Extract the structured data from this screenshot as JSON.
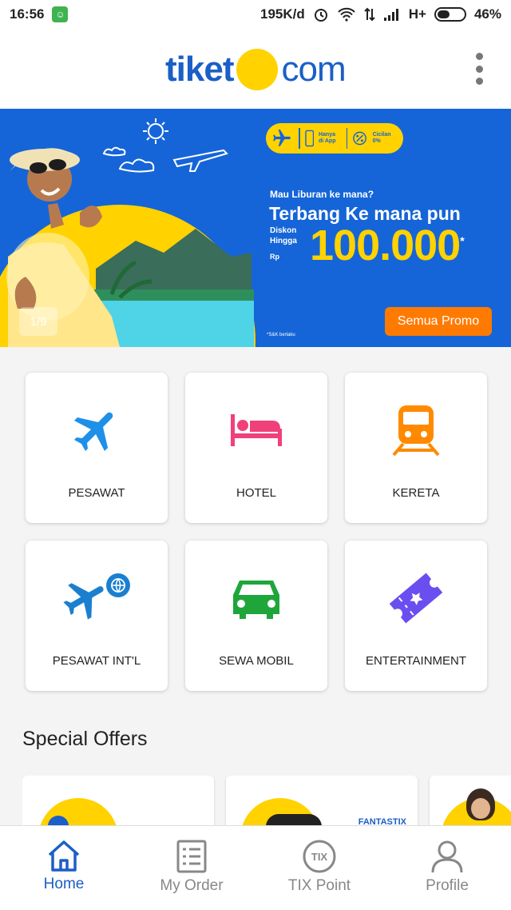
{
  "status_bar": {
    "time": "16:56",
    "network_speed": "195K/d",
    "network_type": "H+",
    "battery": "46%",
    "battery_level": 0.46
  },
  "header": {
    "logo_left": "tiket",
    "logo_right": "com"
  },
  "banner": {
    "badge_app": "Hanya di App",
    "badge_installment": "Cicilan 0%",
    "question": "Mau Liburan ke mana?",
    "headline": "Terbang Ke mana pun",
    "discount_label_1": "Diskon",
    "discount_label_2": "Hingga",
    "currency": "Rp",
    "amount": "100.000",
    "amount_mark": "*",
    "terms": "*S&K berlaku",
    "pager": "1/9",
    "promo_button": "Semua Promo"
  },
  "categories": [
    {
      "label": "PESAWAT",
      "icon": "airplane-icon",
      "color": "#1e90e8"
    },
    {
      "label": "HOTEL",
      "icon": "bed-icon",
      "color": "#f0407a"
    },
    {
      "label": "KERETA",
      "icon": "train-icon",
      "color": "#ff8a00"
    },
    {
      "label": "PESAWAT INT'L",
      "icon": "international-flight-icon",
      "color": "#1b7fd0"
    },
    {
      "label": "SEWA MOBIL",
      "icon": "car-icon",
      "color": "#1fa63a"
    },
    {
      "label": "ENTERTAINMENT",
      "icon": "ticket-icon",
      "color": "#6a4ef0"
    }
  ],
  "special_offers": {
    "title": "Special Offers",
    "card_2_tag": "FANTASTIX"
  },
  "bottom_nav": [
    {
      "label": "Home",
      "icon": "home-icon",
      "active": true
    },
    {
      "label": "My Order",
      "icon": "receipt-icon",
      "active": false
    },
    {
      "label": "TIX Point",
      "icon": "tix-icon",
      "active": false
    },
    {
      "label": "Profile",
      "icon": "person-icon",
      "active": false
    }
  ],
  "colors": {
    "brand_blue": "#1b5fc7",
    "brand_yellow": "#ffd200",
    "promo_orange": "#ff7a00"
  }
}
